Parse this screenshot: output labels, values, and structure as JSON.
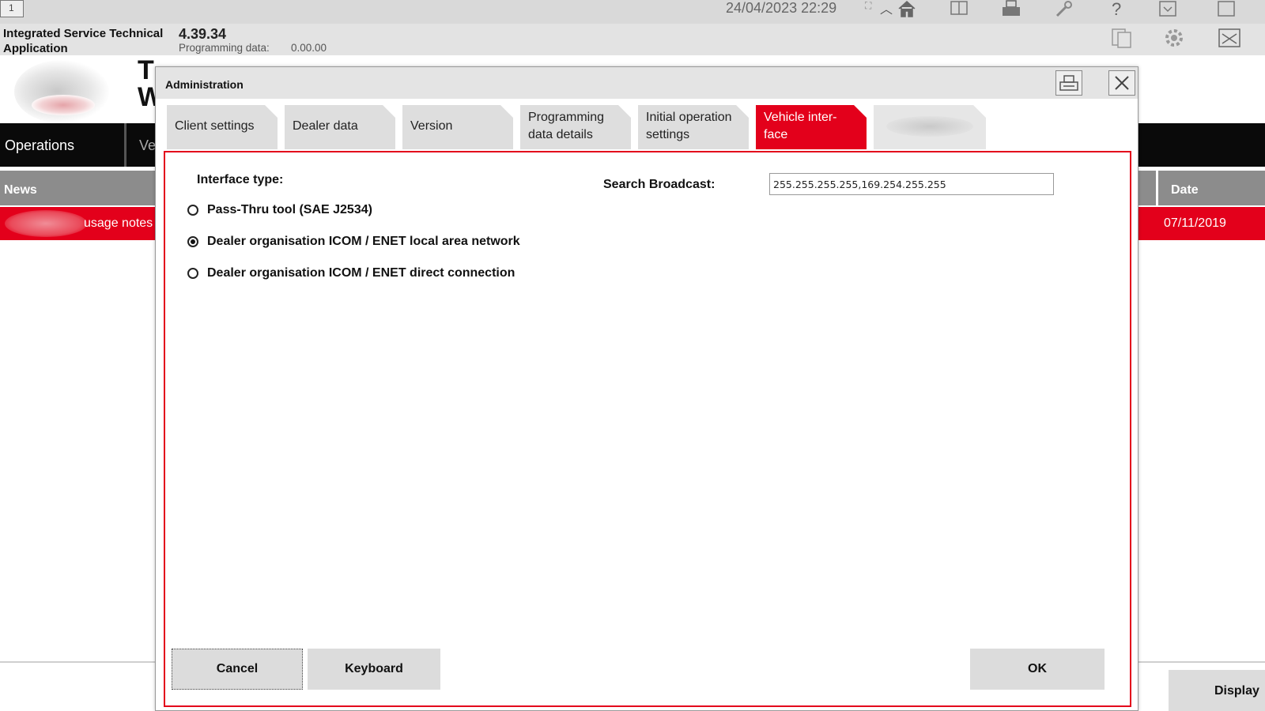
{
  "top_bar": {
    "window_number": "1",
    "datetime": "24/04/2023 22:29",
    "icons": [
      "expand-icon",
      "chevron-up-icon",
      "home-icon",
      "book-icon",
      "printer-icon",
      "wrench-icon",
      "help-icon",
      "download-icon",
      "window-icon"
    ]
  },
  "header": {
    "app_name": "Integrated Service Technical Application",
    "version": "4.39.34",
    "programming_label": "Programming data:",
    "programming_value": "0.00.00",
    "icons": [
      "document-copy-icon",
      "gear-icon",
      "mail-icon"
    ]
  },
  "background": {
    "title_fragment": "T\nW",
    "operations_label": "Operations",
    "second_tab_fragment": "Ve",
    "news_header": "News",
    "date_header": "Date",
    "news_row_text": "usage notes",
    "news_row_date": "07/11/2019",
    "display_button": "Display"
  },
  "dialog": {
    "title": "Administration",
    "tabs": [
      {
        "label": "Client settings",
        "active": false
      },
      {
        "label": "Dealer data",
        "active": false
      },
      {
        "label": "Version",
        "active": false
      },
      {
        "label": "Programming data details",
        "active": false
      },
      {
        "label": "Initial operation settings",
        "active": false
      },
      {
        "label": "Vehicle inter-face",
        "active": true
      },
      {
        "label": "",
        "active": false
      }
    ],
    "interface_type_label": "Interface type:",
    "options": [
      {
        "label": "Pass-Thru tool (SAE J2534)",
        "checked": false
      },
      {
        "label": "Dealer organisation ICOM / ENET local area network",
        "checked": true
      },
      {
        "label": "Dealer organisation ICOM / ENET direct connection",
        "checked": false
      }
    ],
    "search_broadcast_label": "Search Broadcast:",
    "search_broadcast_value": "255.255.255.255,169.254.255.255",
    "buttons": {
      "cancel": "Cancel",
      "keyboard": "Keyboard",
      "ok": "OK"
    }
  },
  "colors": {
    "accent": "#e3001b",
    "black_bar": "#0a0a0a",
    "grey_bar": "#8c8c8c"
  }
}
